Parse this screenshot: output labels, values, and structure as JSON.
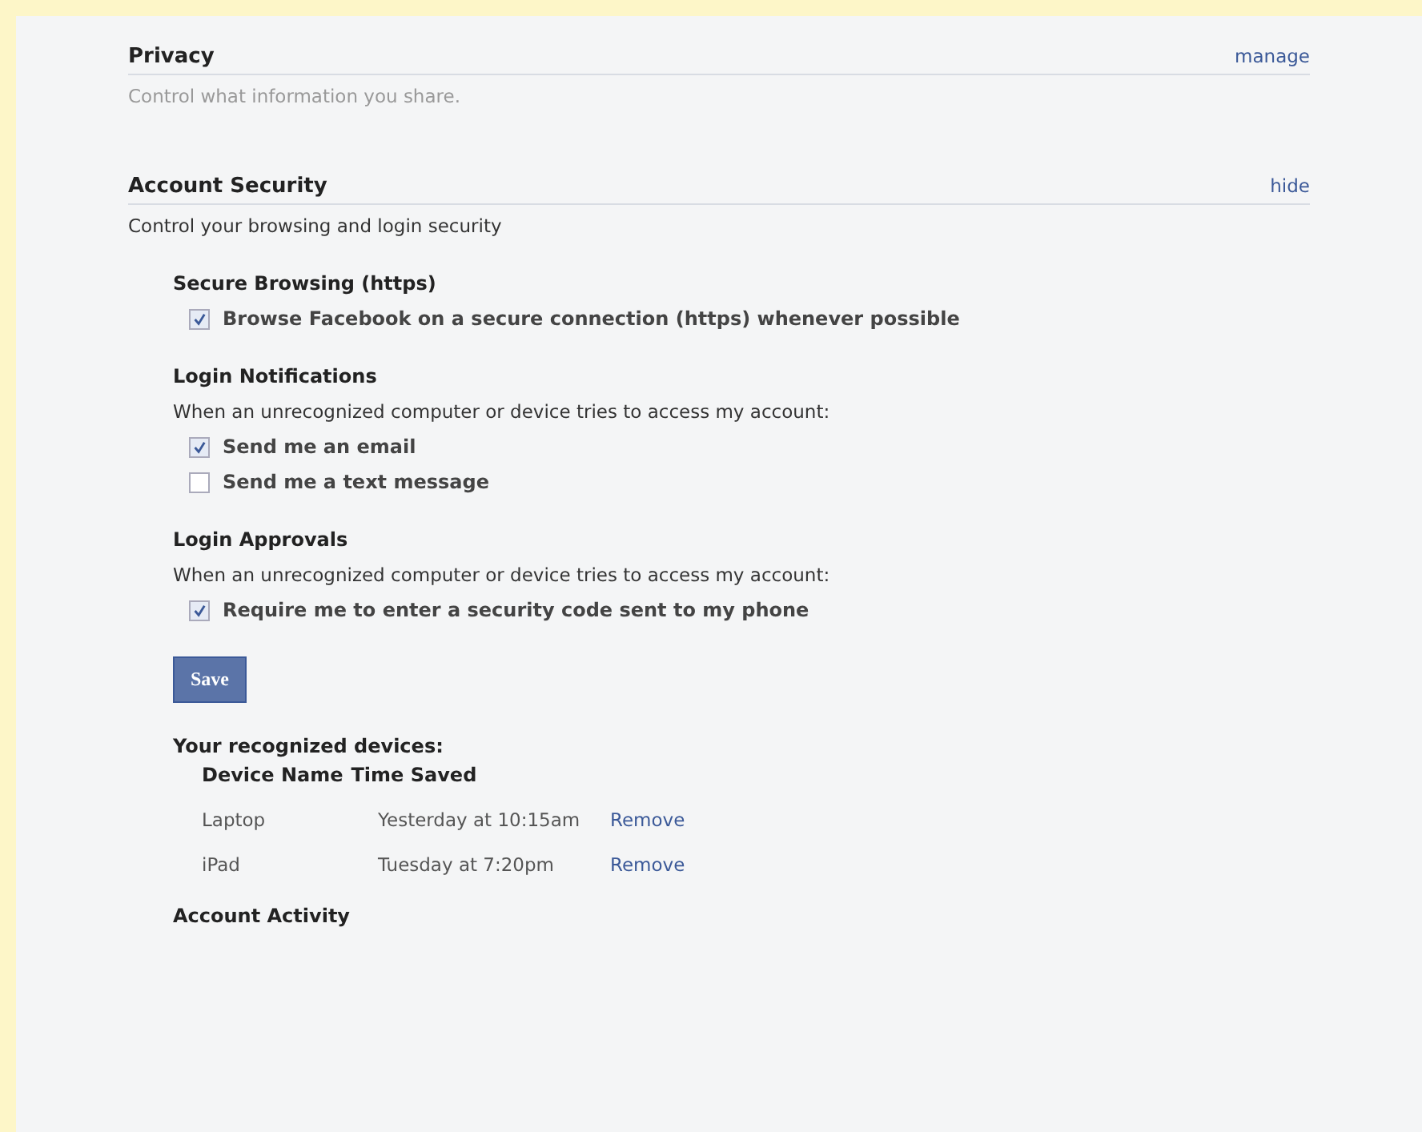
{
  "privacy": {
    "title": "Privacy",
    "link": "manage",
    "description": "Control what information you share."
  },
  "account_security": {
    "title": "Account Security",
    "link": "hide",
    "description": "Control your browsing and login security",
    "groups": [
      {
        "title": "Secure Browsing (https)",
        "options": [
          {
            "label": "Browse Facebook on a secure connection (https) whenever possible",
            "checked": true
          }
        ]
      },
      {
        "title": "Login Notifications",
        "prompt": "When an unrecognized computer or device tries to access my account:",
        "options": [
          {
            "label": "Send me an email",
            "checked": true
          },
          {
            "label": "Send me a text message",
            "checked": false
          }
        ]
      },
      {
        "title": "Login Approvals",
        "prompt": "When an unrecognized computer or device tries to access my account:",
        "options": [
          {
            "label": "Require me to enter a security code sent to my phone",
            "checked": true
          }
        ]
      }
    ],
    "save_button": "Save",
    "devices": {
      "title": "Your recognized devices:",
      "columns": [
        "Device Name",
        "Time Saved"
      ],
      "rows": [
        {
          "device": "Laptop",
          "time": "Yesterday at 10:15am",
          "action": "Remove"
        },
        {
          "device": "iPad",
          "time": "Tuesday at 7:20pm",
          "action": "Remove"
        }
      ]
    },
    "next_section": "Account Activity"
  }
}
